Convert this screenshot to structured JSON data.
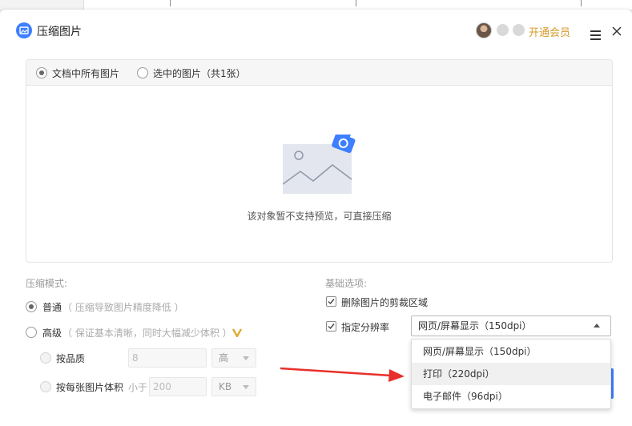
{
  "dialog": {
    "title": "压缩图片",
    "vip_label": "开通会员"
  },
  "preview": {
    "tab_all": "文档中所有图片",
    "tab_selected": "选中的图片（共1张）",
    "message": "该对象暂不支持预览，可直接压缩"
  },
  "compress_mode": {
    "section_label": "压缩模式:",
    "normal_label": "普通",
    "normal_desc": "（ 压缩导致图片精度降低 ）",
    "advanced_label": "高级",
    "advanced_desc": "（ 保证基本清晰，同时大幅减少体积 ）",
    "by_quality_label": "按品质",
    "quality_value": "8",
    "quality_level": "高",
    "by_size_label": "按每张图片体积",
    "size_prefix": "小于",
    "size_value": "200",
    "size_unit": "KB"
  },
  "basic_options": {
    "section_label": "基础选项:",
    "crop_label": "删除图片的剪裁区域",
    "resolution_label": "指定分辨率",
    "resolution_selected": "网页/屏幕显示（150dpi）",
    "resolution_options": [
      "网页/屏幕显示（150dpi）",
      "打印（220dpi）",
      "电子邮件（96dpi）"
    ]
  },
  "colors": {
    "accent": "#3d7fff",
    "vip": "#d49a2a",
    "arrow": "#e8302a"
  }
}
